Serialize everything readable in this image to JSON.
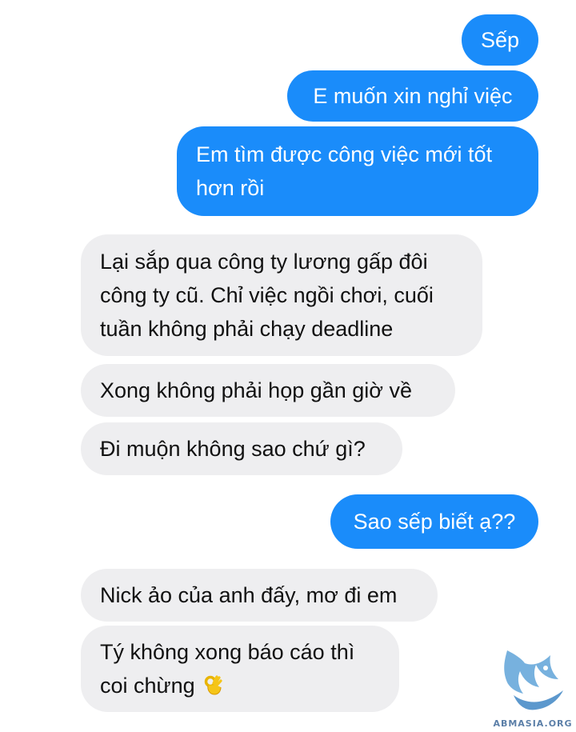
{
  "conversation": {
    "messages": [
      {
        "direction": "outgoing",
        "lines": [
          "Sếp"
        ]
      },
      {
        "direction": "outgoing",
        "lines": [
          "E muốn xin nghỉ việc"
        ]
      },
      {
        "direction": "outgoing",
        "lines": [
          "Em tìm được công việc mới tốt",
          "hơn rồi"
        ]
      },
      {
        "direction": "incoming",
        "lines": [
          "Lại sắp qua công ty lương gấp đôi",
          "công ty cũ. Chỉ việc ngồi chơi, cuối",
          "tuần không phải chạy deadline"
        ]
      },
      {
        "direction": "incoming",
        "lines": [
          "Xong không phải họp gần giờ về"
        ]
      },
      {
        "direction": "incoming",
        "lines": [
          "Đi muộn không sao chứ gì?"
        ]
      },
      {
        "direction": "outgoing",
        "lines": [
          "Sao sếp biết ạ??"
        ]
      },
      {
        "direction": "incoming",
        "lines": [
          "Nick ảo của anh đấy, mơ đi em"
        ]
      },
      {
        "direction": "incoming",
        "lines": [
          "Tý không xong báo cáo thì",
          "coi chừng"
        ],
        "emoji": "ok-hand-emoji"
      }
    ]
  },
  "watermark": {
    "text": "ABMASIA.ORG",
    "icon": "bird-logo"
  },
  "colors": {
    "outgoing_bubble": "#1a8cfa",
    "incoming_bubble": "#eeeef0",
    "outgoing_text": "#ffffff",
    "incoming_text": "#111111"
  }
}
